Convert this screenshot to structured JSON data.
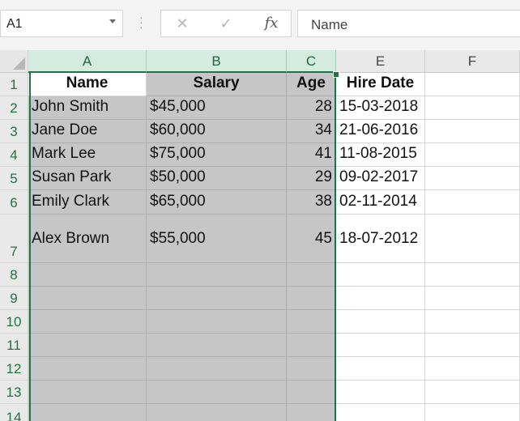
{
  "formula_bar": {
    "name_box": "A1",
    "cancel_glyph": "✕",
    "enter_glyph": "✓",
    "function_glyph": "fx",
    "formula_value": "Name"
  },
  "columns": [
    "A",
    "B",
    "C",
    "E",
    "F"
  ],
  "rows": [
    "1",
    "2",
    "3",
    "4",
    "5",
    "6",
    "7",
    "8",
    "9",
    "10",
    "11",
    "12",
    "13",
    "14"
  ],
  "sheet": {
    "headers": {
      "name": "Name",
      "salary": "Salary",
      "age": "Age",
      "hire_date": "Hire Date"
    },
    "records": [
      {
        "name": "John Smith",
        "salary": "$45,000",
        "age": "28",
        "hire_date": "15-03-2018"
      },
      {
        "name": "Jane Doe",
        "salary": "$60,000",
        "age": "34",
        "hire_date": "21-06-2016"
      },
      {
        "name": "Mark Lee",
        "salary": "$75,000",
        "age": "41",
        "hire_date": "11-08-2015"
      },
      {
        "name": "Susan Park",
        "salary": "$50,000",
        "age": "29",
        "hire_date": "09-02-2017"
      },
      {
        "name": "Emily Clark",
        "salary": "$65,000",
        "age": "38",
        "hire_date": "02-11-2014"
      },
      {
        "name": "Alex Brown",
        "salary": "$55,000",
        "age": "45",
        "hire_date": "18-07-2012"
      }
    ]
  },
  "selection": {
    "active_cell": "A1",
    "columns": [
      "A",
      "B",
      "C"
    ],
    "accent": "#217346",
    "fill": "#c6c6c6"
  }
}
